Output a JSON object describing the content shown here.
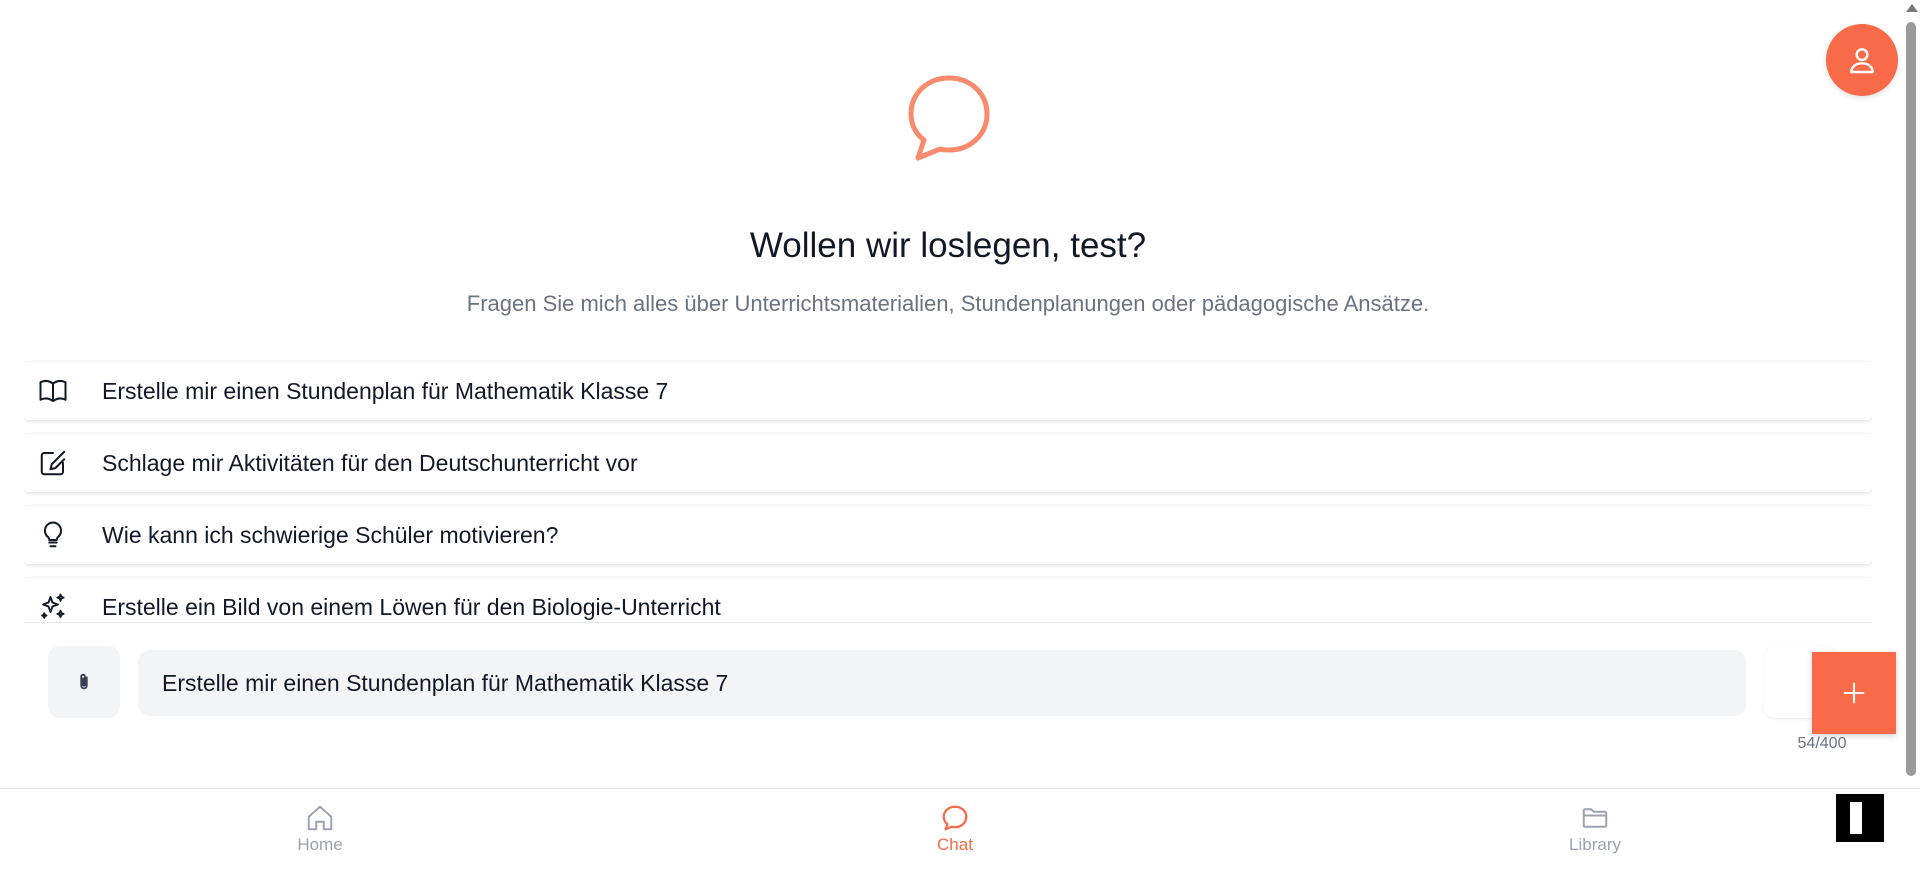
{
  "hero": {
    "title": "Wollen wir loslegen, test?",
    "subtitle": "Fragen Sie mich alles über Unterrichtsmaterialien, Stundenplanungen oder pädagogische Ansätze.",
    "icon": "chat-bubble-icon"
  },
  "suggestions": [
    {
      "icon": "book-open-icon",
      "label": "Erstelle mir einen Stundenplan für Mathematik Klasse 7"
    },
    {
      "icon": "edit-square-icon",
      "label": "Schlage mir Aktivitäten für den Deutschunterricht vor"
    },
    {
      "icon": "lightbulb-icon",
      "label": "Wie kann ich schwierige Schüler motivieren?"
    },
    {
      "icon": "sparkles-icon",
      "label": "Erstelle ein Bild von einem Löwen für den Biologie-Unterricht"
    }
  ],
  "composer": {
    "input_value": "Erstelle mir einen Stundenplan für Mathematik Klasse 7",
    "char_count": "54/400",
    "attach_icon": "paperclip-icon",
    "fab_icon": "plus-icon"
  },
  "bottom_nav": {
    "items": [
      {
        "label": "Home",
        "icon": "home-icon",
        "active": false
      },
      {
        "label": "Chat",
        "icon": "chat-bubble-icon",
        "active": true
      },
      {
        "label": "Library",
        "icon": "folder-icon",
        "active": false
      }
    ]
  },
  "colors": {
    "accent": "#f86a48",
    "text_primary": "#111827",
    "text_secondary": "#6b7280",
    "nav_inactive": "#9ca3af",
    "input_bg": "#f3f4f6"
  }
}
